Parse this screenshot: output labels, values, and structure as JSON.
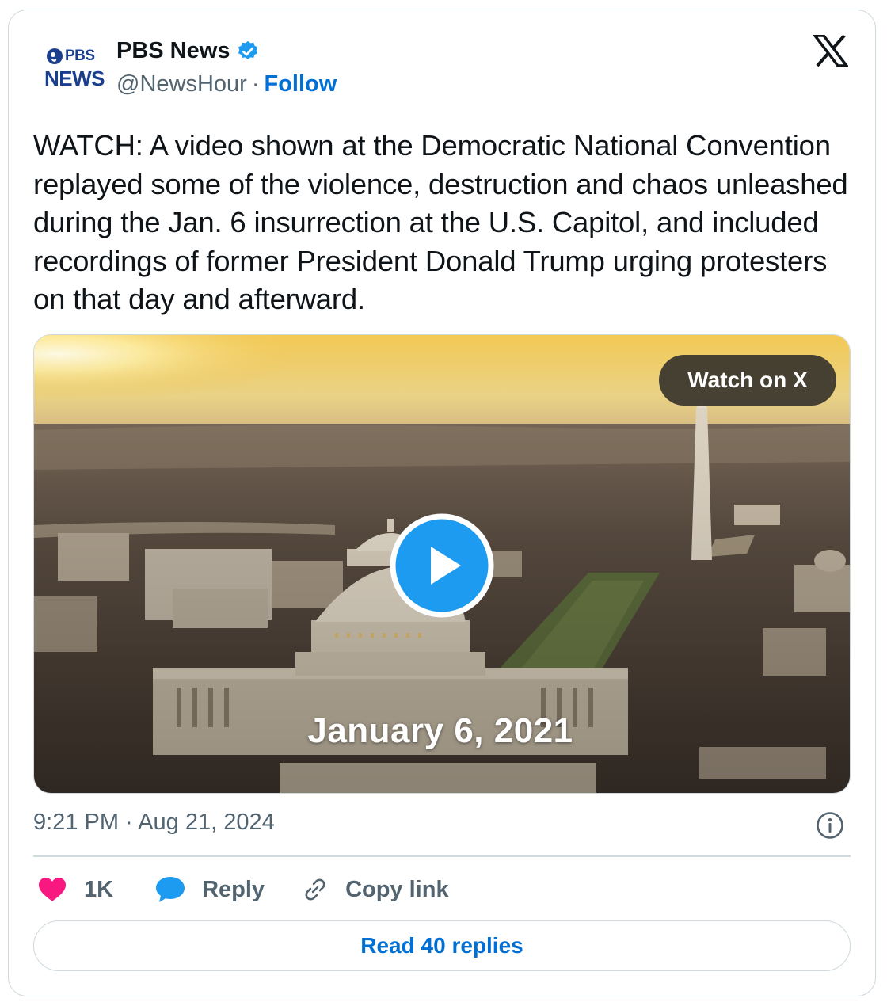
{
  "author": {
    "logo_line1": "PBS",
    "logo_line2": "NEWS",
    "name": "PBS News",
    "handle": "@NewsHour",
    "separator": "·",
    "follow_label": "Follow"
  },
  "tweet": {
    "text": "WATCH: A video shown at the Democratic National Convention replayed some of the violence, destruction and chaos unleashed during the Jan. 6 insurrection at the U.S. Capitol, and included recordings of former President Donald Trump urging protesters on that day and afterward.",
    "timestamp": "9:21 PM · Aug 21, 2024"
  },
  "media": {
    "watch_label": "Watch on X",
    "caption": "January 6, 2021"
  },
  "actions": {
    "like_count": "1K",
    "reply_label": "Reply",
    "copy_label": "Copy link",
    "read_replies_label": "Read 40 replies"
  },
  "colors": {
    "accent": "#1d9bf0",
    "link": "#006fd6",
    "like": "#f91880",
    "border": "#cfd9de",
    "muted": "#536471"
  },
  "icons": [
    "pbs-logo-icon",
    "verified-badge-icon",
    "x-logo-icon",
    "play-icon",
    "info-icon",
    "heart-icon",
    "reply-bubble-icon",
    "link-icon"
  ]
}
